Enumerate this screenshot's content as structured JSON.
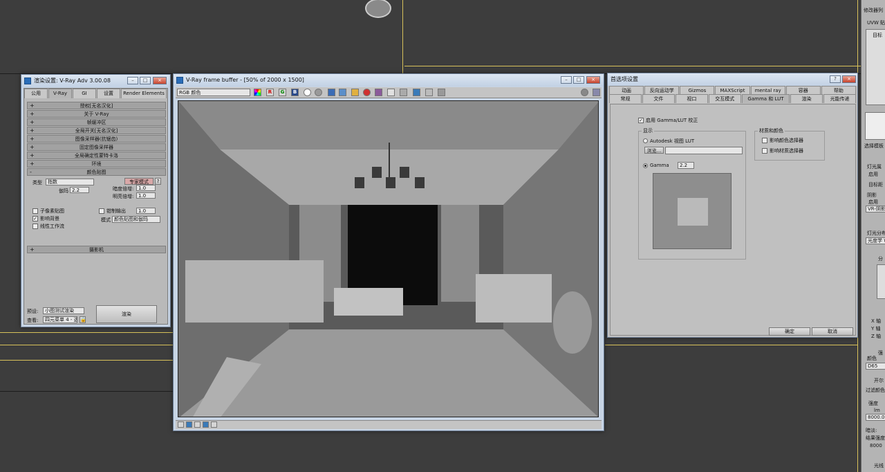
{
  "render_setup": {
    "title": "渲染设置: V-Ray Adv 3.00.08",
    "tabs": [
      "公用",
      "V-Ray",
      "GI",
      "设置",
      "Render Elements"
    ],
    "rollouts": [
      "授权[无名汉化]",
      "关于 V-Ray",
      "帧缓冲区",
      "全局开关[无名汉化]",
      "图像采样器(抗锯齿)",
      "固定图像采样器",
      "全局确定性蒙特卡洛",
      "环境",
      "颜色贴图"
    ],
    "colormap": {
      "type_label": "类型",
      "type_value": "指数",
      "expert_button": "专家模式",
      "help": "?",
      "gamma_label": "伽玛",
      "gamma_value": "2.2",
      "dark_label": "暗度倍增:",
      "dark_value": "1.0",
      "bright_label": "明亮倍增:",
      "bright_value": "1.0",
      "subpixel": "子像素贴图",
      "clamp": "钳制输出",
      "clamp_value": "1.0",
      "affect_bg": "影响背景",
      "linear": "线性工作流",
      "mode_label": "模式",
      "mode_value": "颜色贴图和伽玛"
    },
    "camera_rollout": "摄影机",
    "preset_label": "预设:",
    "preset_value": "小图测试渲染",
    "view_label": "查看:",
    "view_value": "四元菜单 4 - 透",
    "render_button": "渲染"
  },
  "frame_buffer": {
    "title": "V-Ray frame buffer - [50% of 2000 x 1500]",
    "channel": "RGB 颜色",
    "toolbar": [
      "R",
      "G",
      "B"
    ]
  },
  "prefs": {
    "title": "首选项设置",
    "tabs_row1": [
      "动画",
      "反向运动学",
      "Gizmos",
      "MAXScript",
      "mental ray",
      "容器",
      "帮助"
    ],
    "tabs_row2": [
      "常规",
      "文件",
      "视口",
      "交互模式",
      "Gamma 和 LUT",
      "渲染",
      "光能传递"
    ],
    "enable_gamma": "启用 Gamma/LUT 校正",
    "display_group": "显示",
    "autodesk_lut": "Autodesk 视图 LUT",
    "browse": "浏览...",
    "gamma_label": "Gamma",
    "gamma_value": "2.2",
    "mat_group": "材质和颜色",
    "affect_color": "影响颜色选择器",
    "affect_mat": "影响材质选择器",
    "ok": "确定",
    "cancel": "取消"
  },
  "right_panel": {
    "items": [
      "修改器列",
      "UVW 贴",
      "目标",
      "选择模板",
      "灯光属",
      "启用",
      "目标距",
      "阴影",
      "启用",
      "VR-阴影",
      "灯光分布",
      "光度学 W",
      "分",
      "X 轴",
      "Y 轴",
      "Z 轴",
      "强",
      "颜色",
      "D65",
      "开尔",
      "过滤颜色",
      "强度",
      "lm",
      "8000.0",
      "暗淡:",
      "结果强度",
      "8000",
      "光线"
    ]
  }
}
